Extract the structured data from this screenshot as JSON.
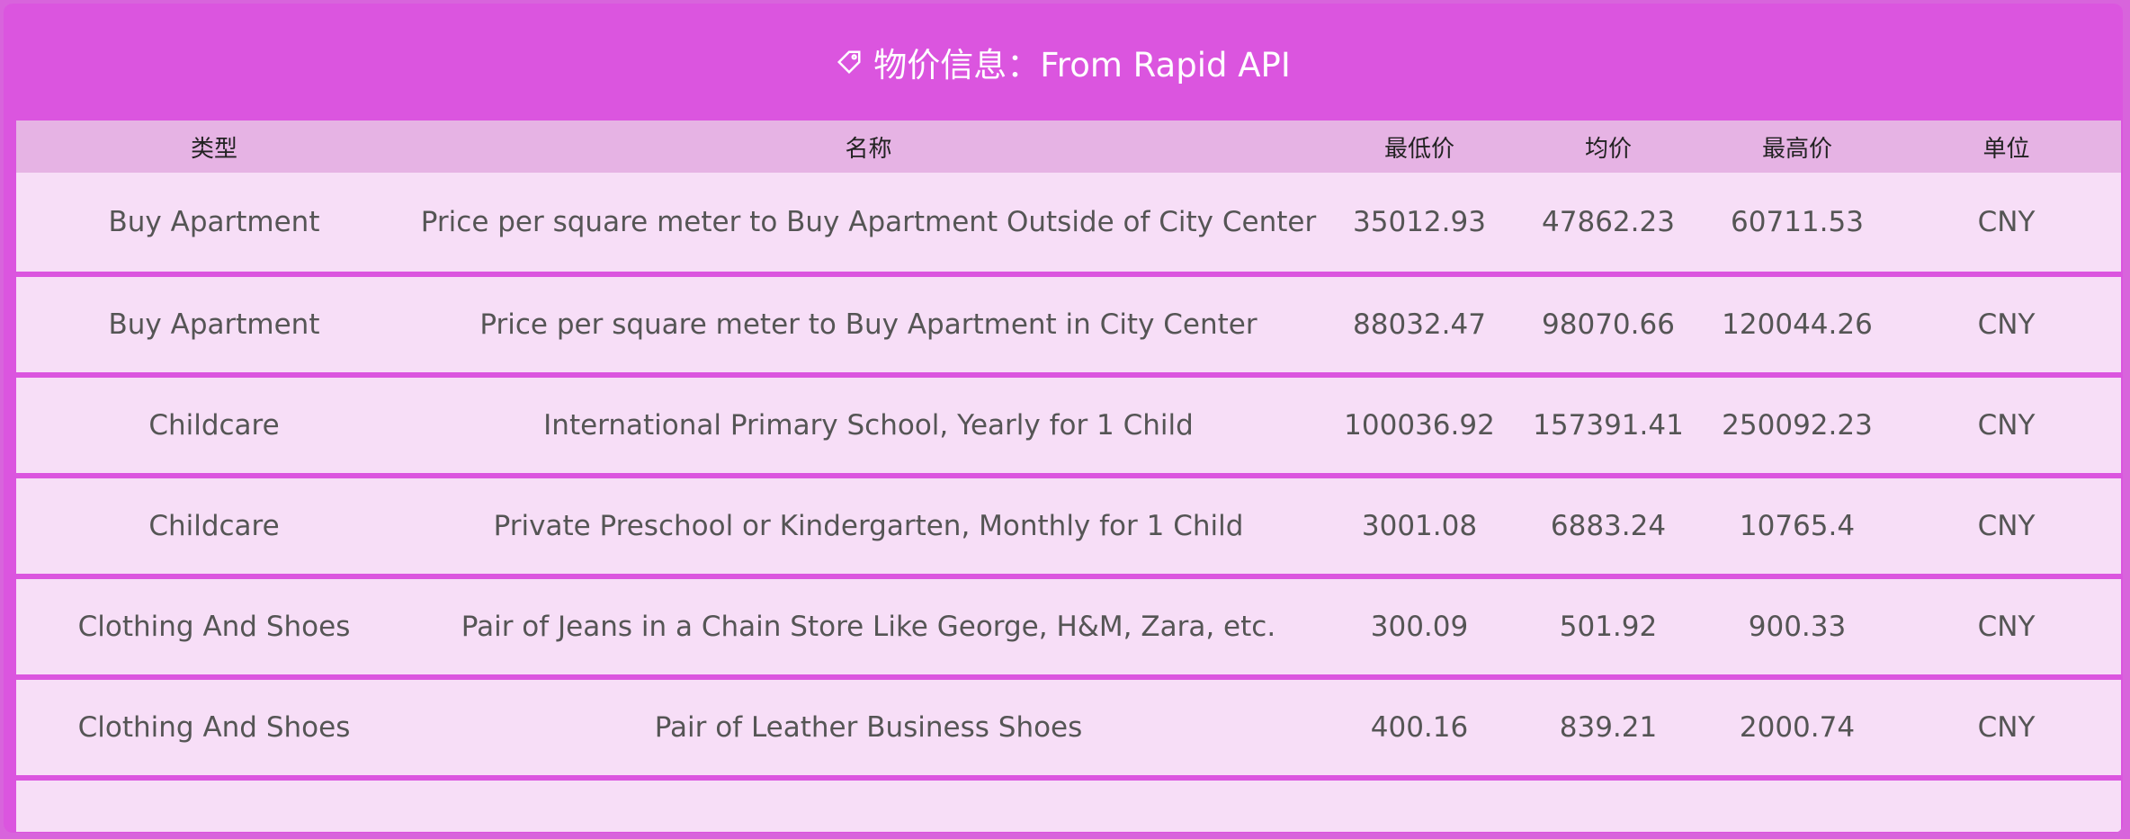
{
  "title": {
    "text": "物价信息：From Rapid API",
    "icon": "tag-icon"
  },
  "table": {
    "headers": [
      "类型",
      "名称",
      "最低价",
      "均价",
      "最高价",
      "单位"
    ],
    "rows": [
      [
        "Buy Apartment",
        "Price per square meter to Buy Apartment Outside of City Center",
        "35012.93",
        "47862.23",
        "60711.53",
        "CNY"
      ],
      [
        "Buy Apartment",
        "Price per square meter to Buy Apartment in City Center",
        "88032.47",
        "98070.66",
        "120044.26",
        "CNY"
      ],
      [
        "Childcare",
        "International Primary School, Yearly for 1 Child",
        "100036.92",
        "157391.41",
        "250092.23",
        "CNY"
      ],
      [
        "Childcare",
        "Private Preschool or Kindergarten, Monthly for 1 Child",
        "3001.08",
        "6883.24",
        "10765.4",
        "CNY"
      ],
      [
        "Clothing And Shoes",
        "Pair of Jeans in a Chain Store Like George, H&M, Zara, etc.",
        "300.09",
        "501.92",
        "900.33",
        "CNY"
      ],
      [
        "Clothing And Shoes",
        "Pair of Leather Business Shoes",
        "400.16",
        "839.21",
        "2000.74",
        "CNY"
      ]
    ]
  },
  "colors": {
    "panel": "#db55df",
    "header_row": "#e6b3e4",
    "row_bg": "#f7def7"
  }
}
